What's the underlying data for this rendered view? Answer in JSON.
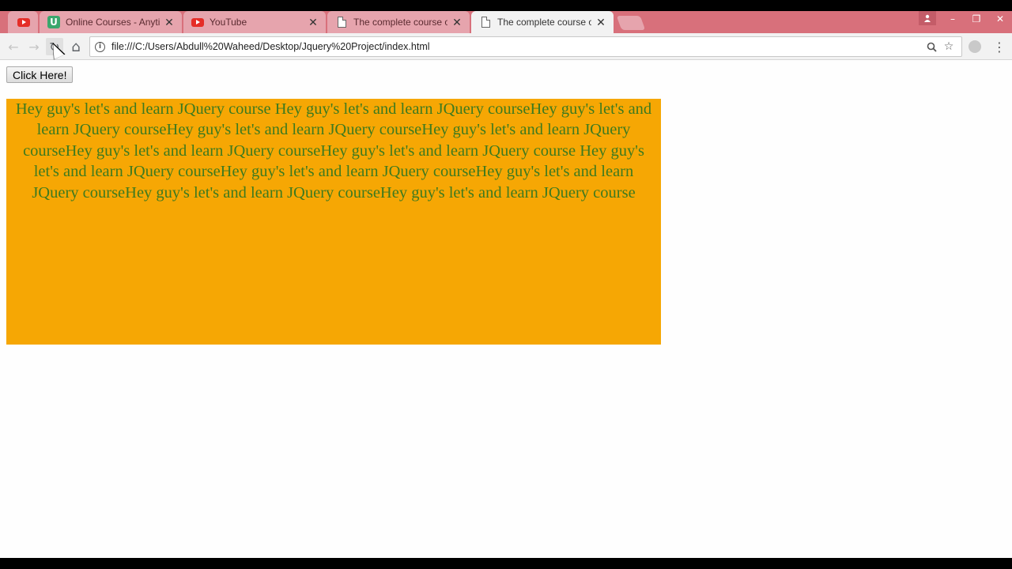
{
  "browser": {
    "tabs": [
      {
        "title": "",
        "icon": "youtube-icon"
      },
      {
        "title": "Online Courses - Anytim",
        "icon": "udemy-icon"
      },
      {
        "title": "YouTube",
        "icon": "youtube-icon"
      },
      {
        "title": "The complete course of",
        "icon": "document-icon"
      },
      {
        "title": "The complete course of",
        "icon": "document-icon",
        "active": true
      }
    ],
    "close_glyph": "✕",
    "address_bar": {
      "url": "file:///C:/Users/Abdull%20Waheed/Desktop/Jquery%20Project/index.html"
    },
    "nav": {
      "back_glyph": "←",
      "forward_glyph": "→",
      "reload_glyph": "↻",
      "home_glyph": "⌂"
    },
    "window_controls": {
      "minimize": "–",
      "restore": "❐",
      "close": "✕"
    },
    "colors": {
      "tabstrip": "#d8707b",
      "inactive_tab": "#e6a4ad"
    }
  },
  "page": {
    "button_label": "Click Here!",
    "box_text": "Hey guy's let's and learn JQuery course Hey guy's let's and learn JQuery courseHey guy's let's and learn JQuery courseHey guy's let's and learn JQuery courseHey guy's let's and learn JQuery courseHey guy's let's and learn JQuery courseHey guy's let's and learn JQuery course Hey guy's let's and learn JQuery courseHey guy's let's and learn JQuery courseHey guy's let's and learn JQuery courseHey guy's let's and learn JQuery courseHey guy's let's and learn JQuery course",
    "colors": {
      "box_background": "#f6a704",
      "box_text": "#3d7a1f"
    }
  }
}
